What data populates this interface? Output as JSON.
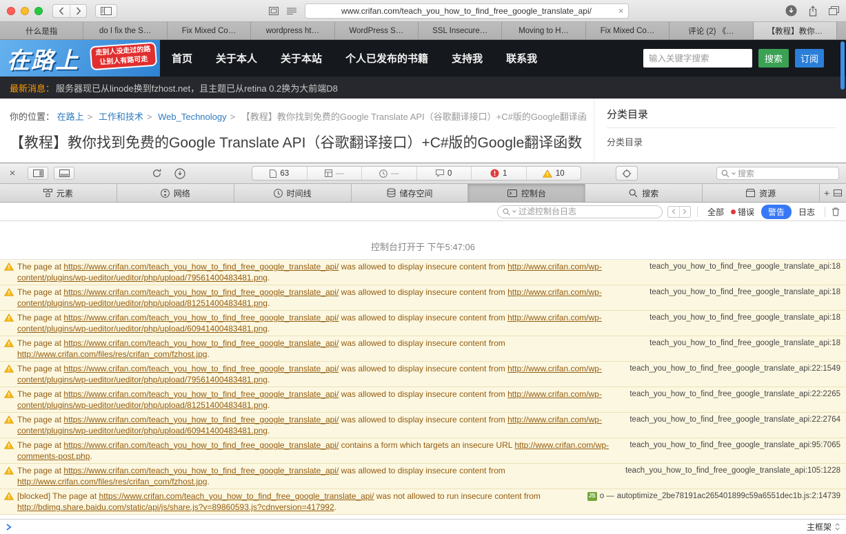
{
  "icons": {
    "close": "×",
    "plus": "+",
    "dash": "—"
  },
  "browser": {
    "url": "www.crifan.com/teach_you_how_to_find_free_google_translate_api/",
    "tabs": [
      {
        "label": "什么是指"
      },
      {
        "label": "do I fix the S…"
      },
      {
        "label": "Fix Mixed Co…"
      },
      {
        "label": "wordpress ht…"
      },
      {
        "label": "WordPress S…"
      },
      {
        "label": "SSL Insecure…"
      },
      {
        "label": "Moving to H…"
      },
      {
        "label": "Fix Mixed Co…"
      },
      {
        "label": "评论 (2) 《…"
      },
      {
        "label": "【教程】教你…",
        "active": true
      }
    ]
  },
  "site": {
    "logo_text": "在路上",
    "logo_badge_line1": "走别人没走过的路",
    "logo_badge_line2": "让别人有路可走",
    "nav": [
      "首页",
      "关于本人",
      "关于本站",
      "个人已发布的书籍",
      "支持我",
      "联系我"
    ],
    "search_placeholder": "输入关键字搜索",
    "search_button": "搜索",
    "subscribe_button": "订阅",
    "news_label": "最新消息：",
    "news_text": "服务器现已从linode换到fzhost.net，且主题已从retina 0.2换为大前端D8",
    "breadcrumb_label": "你的位置：",
    "breadcrumb_links": [
      "在路上",
      "工作和技术",
      "Web_Technology"
    ],
    "breadcrumb_current": "【教程】教你找到免费的Google Translate API（谷歌翻译接口）+C#版的Google翻译函数",
    "page_title": "【教程】教你找到免费的Google Translate API（谷歌翻译接口）+C#版的Google翻译函数",
    "sidebar_heading": "分类目录",
    "sidebar_widget_label": "分类目录"
  },
  "inspector": {
    "resources": [
      {
        "icon": "document-icon",
        "value": "63"
      },
      {
        "icon": "layout-grid-icon",
        "value": "—"
      },
      {
        "icon": "clock-icon",
        "value": "—"
      },
      {
        "icon": "console-bubble-icon",
        "value": "0"
      },
      {
        "icon": "error-badge-icon",
        "value": "1"
      },
      {
        "icon": "warning-badge-icon",
        "value": "10"
      }
    ],
    "search_placeholder": "搜索",
    "tabs": [
      {
        "icon": "elements-icon",
        "label": "元素"
      },
      {
        "icon": "network-icon",
        "label": "网络"
      },
      {
        "icon": "timeline-icon",
        "label": "时间线"
      },
      {
        "icon": "storage-icon",
        "label": "储存空间"
      },
      {
        "icon": "console-icon",
        "label": "控制台",
        "active": true
      },
      {
        "icon": "search-icon",
        "label": "搜索"
      },
      {
        "icon": "resources-icon",
        "label": "资源"
      }
    ],
    "filter": {
      "placeholder": "过滤控制台日志",
      "all": "全部",
      "errors": "错误",
      "warnings": "警告",
      "logs": "日志"
    },
    "console": {
      "opened_message": "控制台打开于 下午5:47:06",
      "warnings": [
        {
          "parts": [
            {
              "text": "The page at ",
              "link": false
            },
            {
              "text": "https://www.crifan.com/teach_you_how_to_find_free_google_translate_api/",
              "link": true
            },
            {
              "text": " was allowed to display insecure content from ",
              "link": false
            },
            {
              "text": "http://www.crifan.com/wp-content/plugins/wp-ueditor/ueditor/php/upload/79561400483481.png",
              "link": true
            },
            {
              "text": ".",
              "link": false
            }
          ],
          "location": "teach_you_how_to_find_free_google_translate_api:18"
        },
        {
          "parts": [
            {
              "text": "The page at ",
              "link": false
            },
            {
              "text": "https://www.crifan.com/teach_you_how_to_find_free_google_translate_api/",
              "link": true
            },
            {
              "text": " was allowed to display insecure content from ",
              "link": false
            },
            {
              "text": "http://www.crifan.com/wp-content/plugins/wp-ueditor/ueditor/php/upload/81251400483481.png",
              "link": true
            },
            {
              "text": ".",
              "link": false
            }
          ],
          "location": "teach_you_how_to_find_free_google_translate_api:18"
        },
        {
          "parts": [
            {
              "text": "The page at ",
              "link": false
            },
            {
              "text": "https://www.crifan.com/teach_you_how_to_find_free_google_translate_api/",
              "link": true
            },
            {
              "text": " was allowed to display insecure content from ",
              "link": false
            },
            {
              "text": "http://www.crifan.com/wp-content/plugins/wp-ueditor/ueditor/php/upload/60941400483481.png",
              "link": true
            },
            {
              "text": ".",
              "link": false
            }
          ],
          "location": "teach_you_how_to_find_free_google_translate_api:18"
        },
        {
          "parts": [
            {
              "text": "The page at ",
              "link": false
            },
            {
              "text": "https://www.crifan.com/teach_you_how_to_find_free_google_translate_api/",
              "link": true
            },
            {
              "text": " was allowed to display insecure content from ",
              "link": false
            },
            {
              "text": "http://www.crifan.com/files/res/crifan_com/fzhost.jpg",
              "link": true
            },
            {
              "text": ".",
              "link": false
            }
          ],
          "location": "teach_you_how_to_find_free_google_translate_api:18"
        },
        {
          "parts": [
            {
              "text": "The page at ",
              "link": false
            },
            {
              "text": "https://www.crifan.com/teach_you_how_to_find_free_google_translate_api/",
              "link": true
            },
            {
              "text": " was allowed to display insecure content from ",
              "link": false
            },
            {
              "text": "http://www.crifan.com/wp-content/plugins/wp-ueditor/ueditor/php/upload/79561400483481.png",
              "link": true
            },
            {
              "text": ".",
              "link": false
            }
          ],
          "location": "teach_you_how_to_find_free_google_translate_api:22:1549"
        },
        {
          "parts": [
            {
              "text": "The page at ",
              "link": false
            },
            {
              "text": "https://www.crifan.com/teach_you_how_to_find_free_google_translate_api/",
              "link": true
            },
            {
              "text": " was allowed to display insecure content from ",
              "link": false
            },
            {
              "text": "http://www.crifan.com/wp-content/plugins/wp-ueditor/ueditor/php/upload/81251400483481.png",
              "link": true
            },
            {
              "text": ".",
              "link": false
            }
          ],
          "location": "teach_you_how_to_find_free_google_translate_api:22:2265"
        },
        {
          "parts": [
            {
              "text": "The page at ",
              "link": false
            },
            {
              "text": "https://www.crifan.com/teach_you_how_to_find_free_google_translate_api/",
              "link": true
            },
            {
              "text": " was allowed to display insecure content from ",
              "link": false
            },
            {
              "text": "http://www.crifan.com/wp-content/plugins/wp-ueditor/ueditor/php/upload/60941400483481.png",
              "link": true
            },
            {
              "text": ".",
              "link": false
            }
          ],
          "location": "teach_you_how_to_find_free_google_translate_api:22:2764"
        },
        {
          "parts": [
            {
              "text": "The page at ",
              "link": false
            },
            {
              "text": "https://www.crifan.com/teach_you_how_to_find_free_google_translate_api/",
              "link": true
            },
            {
              "text": " contains a form which targets an insecure URL ",
              "link": false
            },
            {
              "text": "http://www.crifan.com/wp-comments-post.php",
              "link": true
            },
            {
              "text": ".",
              "link": false
            }
          ],
          "location": "teach_you_how_to_find_free_google_translate_api:95:7065"
        },
        {
          "parts": [
            {
              "text": "The page at ",
              "link": false
            },
            {
              "text": "https://www.crifan.com/teach_you_how_to_find_free_google_translate_api/",
              "link": true
            },
            {
              "text": " was allowed to display insecure content from ",
              "link": false
            },
            {
              "text": "http://www.crifan.com/files/res/crifan_com/fzhost.jpg",
              "link": true
            },
            {
              "text": ".",
              "link": false
            }
          ],
          "location": "teach_you_how_to_find_free_google_translate_api:105:1228"
        },
        {
          "parts": [
            {
              "text": "[blocked] The page at ",
              "link": false
            },
            {
              "text": "https://www.crifan.com/teach_you_how_to_find_free_google_translate_api/",
              "link": true
            },
            {
              "text": " was not allowed to run insecure content from ",
              "link": false
            },
            {
              "text": "http://bdimg.share.baidu.com/static/api/js/share.js?v=89860593.js?cdnversion=417992",
              "link": true
            },
            {
              "text": ".",
              "link": false
            }
          ],
          "badge": "JS",
          "caller": "o —",
          "location": "autoptimize_2be78191ac265401899c59a6551dec1b.js:2:14739"
        }
      ]
    },
    "bottom": {
      "frame": "主框架"
    }
  }
}
